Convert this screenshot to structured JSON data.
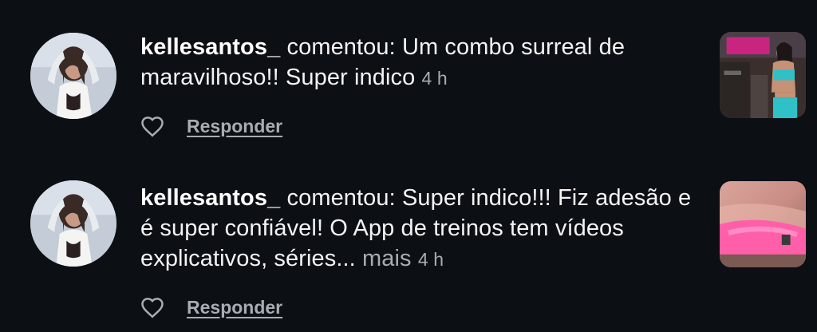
{
  "notifications": [
    {
      "username": "kellesantos_",
      "text": "comentou: Um combo surreal de maravilhoso!! Super indico",
      "more": "",
      "time": "4 h",
      "reply_label": "Responder",
      "thumb_banner": "",
      "like_icon": "heart-outline"
    },
    {
      "username": "kellesantos_",
      "text": "comentou: Super indico!!! Fiz adesão e é super confiável! O App de treinos tem vídeos explicativos, séries...",
      "more": "mais",
      "time": "4 h",
      "reply_label": "Responder",
      "like_icon": "heart-outline"
    }
  ],
  "colors": {
    "background": "#0c0f14",
    "primary_text": "#f2f3f5",
    "secondary_text": "#a8acb3"
  }
}
